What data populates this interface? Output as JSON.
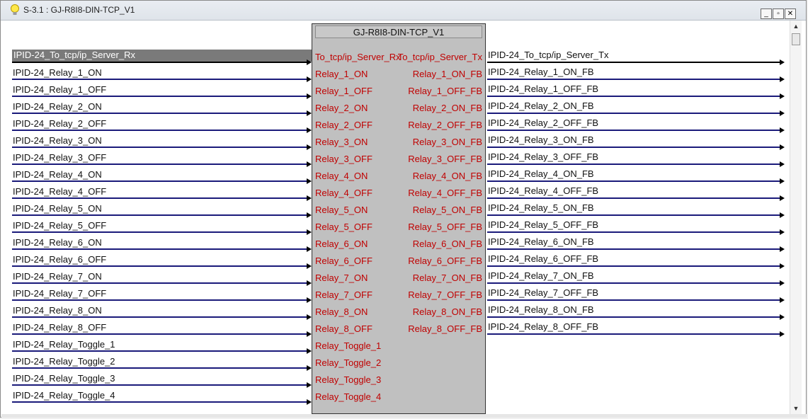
{
  "window": {
    "title": "S-3.1 : GJ-R8I8-DIN-TCP_V1",
    "minimize_glyph": "_",
    "restore_glyph": "▫",
    "close_glyph": "✕"
  },
  "scrollbar": {
    "up_glyph": "▲",
    "down_glyph": "▼"
  },
  "block": {
    "name": "GJ-R8I8-DIN-TCP_V1",
    "input_pins": [
      "To_tcp/ip_Server_Rx",
      "Relay_1_ON",
      "Relay_1_OFF",
      "Relay_2_ON",
      "Relay_2_OFF",
      "Relay_3_ON",
      "Relay_3_OFF",
      "Relay_4_ON",
      "Relay_4_OFF",
      "Relay_5_ON",
      "Relay_5_OFF",
      "Relay_6_ON",
      "Relay_6_OFF",
      "Relay_7_ON",
      "Relay_7_OFF",
      "Relay_8_ON",
      "Relay_8_OFF",
      "Relay_Toggle_1",
      "Relay_Toggle_2",
      "Relay_Toggle_3",
      "Relay_Toggle_4"
    ],
    "output_pins": [
      "To_tcp/ip_Server_Tx",
      "Relay_1_ON_FB",
      "Relay_1_OFF_FB",
      "Relay_2_ON_FB",
      "Relay_2_OFF_FB",
      "Relay_3_ON_FB",
      "Relay_3_OFF_FB",
      "Relay_4_ON_FB",
      "Relay_4_OFF_FB",
      "Relay_5_ON_FB",
      "Relay_5_OFF_FB",
      "Relay_6_ON_FB",
      "Relay_6_OFF_FB",
      "Relay_7_ON_FB",
      "Relay_7_OFF_FB",
      "Relay_8_ON_FB",
      "Relay_8_OFF_FB"
    ]
  },
  "input_signals": [
    "IPID-24_To_tcp/ip_Server_Rx",
    "IPID-24_Relay_1_ON",
    "IPID-24_Relay_1_OFF",
    "IPID-24_Relay_2_ON",
    "IPID-24_Relay_2_OFF",
    "IPID-24_Relay_3_ON",
    "IPID-24_Relay_3_OFF",
    "IPID-24_Relay_4_ON",
    "IPID-24_Relay_4_OFF",
    "IPID-24_Relay_5_ON",
    "IPID-24_Relay_5_OFF",
    "IPID-24_Relay_6_ON",
    "IPID-24_Relay_6_OFF",
    "IPID-24_Relay_7_ON",
    "IPID-24_Relay_7_OFF",
    "IPID-24_Relay_8_ON",
    "IPID-24_Relay_8_OFF",
    "IPID-24_Relay_Toggle_1",
    "IPID-24_Relay_Toggle_2",
    "IPID-24_Relay_Toggle_3",
    "IPID-24_Relay_Toggle_4"
  ],
  "output_signals": [
    "IPID-24_To_tcp/ip_Server_Tx",
    "IPID-24_Relay_1_ON_FB",
    "IPID-24_Relay_1_OFF_FB",
    "IPID-24_Relay_2_ON_FB",
    "IPID-24_Relay_2_OFF_FB",
    "IPID-24_Relay_3_ON_FB",
    "IPID-24_Relay_3_OFF_FB",
    "IPID-24_Relay_4_ON_FB",
    "IPID-24_Relay_4_OFF_FB",
    "IPID-24_Relay_5_ON_FB",
    "IPID-24_Relay_5_OFF_FB",
    "IPID-24_Relay_6_ON_FB",
    "IPID-24_Relay_6_OFF_FB",
    "IPID-24_Relay_7_ON_FB",
    "IPID-24_Relay_7_OFF_FB",
    "IPID-24_Relay_8_ON_FB",
    "IPID-24_Relay_8_OFF_FB"
  ],
  "colors": {
    "pin_text": "#c00000",
    "signal_line": "#1a1a7a",
    "selected_signal_bg": "#7a7a7a",
    "block_bg": "#c0c0c0"
  }
}
